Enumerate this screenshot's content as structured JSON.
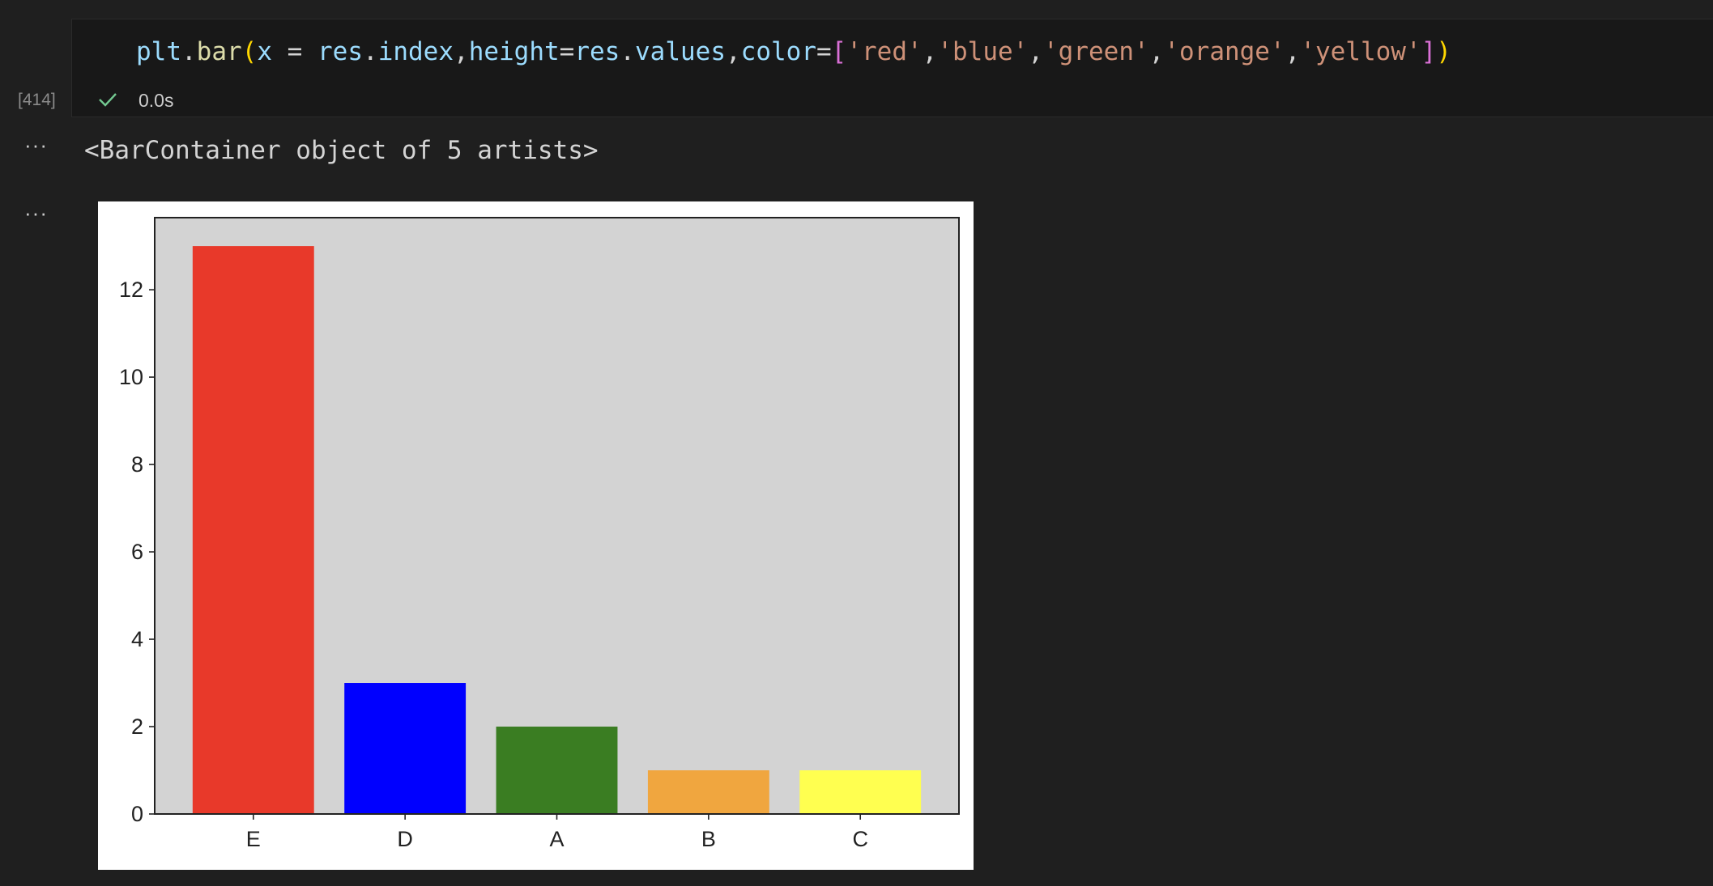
{
  "cell": {
    "execution_count": "[414]",
    "exec_time": "0.0s",
    "code_tokens": [
      {
        "text": "plt",
        "color": "#9cdcfe"
      },
      {
        "text": ".",
        "color": "#d4d4d4"
      },
      {
        "text": "bar",
        "color": "#dcdcaa"
      },
      {
        "text": "(",
        "color": "#ffd700"
      },
      {
        "text": "x",
        "color": "#9cdcfe"
      },
      {
        "text": " = ",
        "color": "#d4d4d4"
      },
      {
        "text": "res",
        "color": "#9cdcfe"
      },
      {
        "text": ".",
        "color": "#d4d4d4"
      },
      {
        "text": "index",
        "color": "#9cdcfe"
      },
      {
        "text": ",",
        "color": "#d4d4d4"
      },
      {
        "text": "height",
        "color": "#9cdcfe"
      },
      {
        "text": "=",
        "color": "#d4d4d4"
      },
      {
        "text": "res",
        "color": "#9cdcfe"
      },
      {
        "text": ".",
        "color": "#d4d4d4"
      },
      {
        "text": "values",
        "color": "#9cdcfe"
      },
      {
        "text": ",",
        "color": "#d4d4d4"
      },
      {
        "text": "color",
        "color": "#9cdcfe"
      },
      {
        "text": "=",
        "color": "#d4d4d4"
      },
      {
        "text": "[",
        "color": "#da70d6"
      },
      {
        "text": "'red'",
        "color": "#ce9178"
      },
      {
        "text": ",",
        "color": "#d4d4d4"
      },
      {
        "text": "'blue'",
        "color": "#ce9178"
      },
      {
        "text": ",",
        "color": "#d4d4d4"
      },
      {
        "text": "'green'",
        "color": "#ce9178"
      },
      {
        "text": ",",
        "color": "#d4d4d4"
      },
      {
        "text": "'orange'",
        "color": "#ce9178"
      },
      {
        "text": ",",
        "color": "#d4d4d4"
      },
      {
        "text": "'yellow'",
        "color": "#ce9178"
      },
      {
        "text": "]",
        "color": "#da70d6"
      },
      {
        "text": ")",
        "color": "#ffd700"
      }
    ]
  },
  "output": {
    "ellipsis": "···",
    "text": "<BarContainer object of 5 artists>"
  },
  "chart_data": {
    "type": "bar",
    "categories": [
      "E",
      "D",
      "A",
      "B",
      "C"
    ],
    "values": [
      13,
      3,
      2,
      1,
      1
    ],
    "colors": [
      "#e8392a",
      "#0000ff",
      "#3a7d22",
      "#f0a63f",
      "#ffff50"
    ],
    "ylim": [
      0,
      13.65
    ],
    "yticks": [
      0,
      2,
      4,
      6,
      8,
      10,
      12
    ],
    "title": "",
    "xlabel": "",
    "ylabel": "",
    "grid": false,
    "axes_facecolor": "#d3d3d3"
  }
}
